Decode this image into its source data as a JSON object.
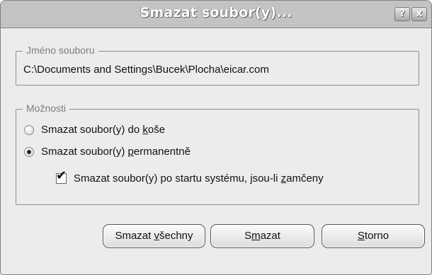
{
  "window": {
    "title": "Smazat soubor(y)...",
    "help_glyph": "?",
    "close_glyph": "x"
  },
  "file_group": {
    "label": "Jméno souboru",
    "path": "C:\\Documents and Settings\\Bucek\\Plocha\\eicar.com"
  },
  "options_group": {
    "label": "Možnosti",
    "recycle": {
      "pre": "Smazat soubor(y) do ",
      "accel": "k",
      "post": "oše",
      "checked": false
    },
    "permanent": {
      "pre": "Smazat soubor(y) ",
      "accel": "p",
      "post": "ermanentně",
      "checked": true
    },
    "after_restart": {
      "pre": "Smazat soubor(y) po startu systému, jsou-li ",
      "accel": "z",
      "post": "amčeny",
      "checked": true,
      "tick": "✔"
    }
  },
  "buttons": {
    "delete_all": {
      "pre": "Smazat ",
      "accel": "v",
      "post": "šechny"
    },
    "delete": {
      "pre": "S",
      "accel": "m",
      "post": "azat"
    },
    "cancel": {
      "pre": "",
      "accel": "S",
      "post": "torno"
    }
  }
}
